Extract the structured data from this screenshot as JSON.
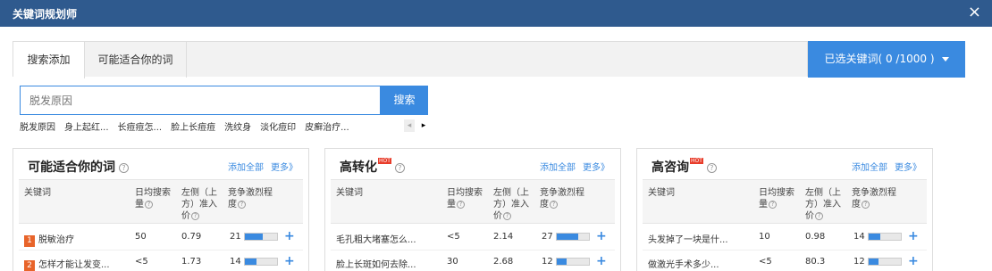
{
  "window": {
    "title": "关键词规划师",
    "close": "×"
  },
  "tabs": [
    {
      "label": "搜索添加"
    },
    {
      "label": "可能适合你的词"
    }
  ],
  "selected_button": {
    "label": "已选关键词( 0 /1000 )"
  },
  "search": {
    "placeholder": "脱发原因",
    "button": "搜索"
  },
  "suggestions": [
    "脱发原因",
    "身上起红...",
    "长痘痘怎...",
    "脸上长痘痘",
    "洗纹身",
    "淡化痘印",
    "皮癣治疗..."
  ],
  "suggest_nav": {
    "prev": "◂",
    "next": "▸"
  },
  "panels": [
    {
      "title": "可能适合你的词",
      "hot": "",
      "links": [
        "添加全部",
        "更多》"
      ],
      "headers": [
        "关键词",
        "日均搜索量",
        "左侧（上方）准入价",
        "竞争激烈程度"
      ],
      "rows": [
        {
          "rank": "1",
          "keyword": "脱敏治疗",
          "daily": "50",
          "price": "0.79",
          "competition": "21",
          "level": 0.55
        },
        {
          "rank": "2",
          "keyword": "怎样才能让发变...",
          "daily": "<5",
          "price": "1.73",
          "competition": "14",
          "level": 0.35
        }
      ]
    },
    {
      "title": "高转化",
      "hot": "HOT",
      "links": [
        "添加全部",
        "更多》"
      ],
      "headers": [
        "关键词",
        "日均搜索量",
        "左侧（上方）准入价",
        "竞争激烈程度"
      ],
      "rows": [
        {
          "rank": "",
          "keyword": "毛孔粗大堵塞怎么...",
          "daily": "<5",
          "price": "2.14",
          "competition": "27",
          "level": 0.68
        },
        {
          "rank": "",
          "keyword": "脸上长斑如何去除...",
          "daily": "30",
          "price": "2.68",
          "competition": "12",
          "level": 0.3
        }
      ]
    },
    {
      "title": "高咨询",
      "hot": "HOT",
      "links": [
        "添加全部",
        "更多》"
      ],
      "headers": [
        "关键词",
        "日均搜索量",
        "左侧（上方）准入价",
        "竞争激烈程度"
      ],
      "rows": [
        {
          "rank": "",
          "keyword": "头发掉了一块是什...",
          "daily": "10",
          "price": "0.98",
          "competition": "14",
          "level": 0.35
        },
        {
          "rank": "",
          "keyword": "做激光手术多少...",
          "daily": "<5",
          "price": "80.3",
          "competition": "12",
          "level": 0.3
        }
      ]
    }
  ],
  "colors": {
    "accent": "#3a8ae0",
    "titlebar": "#2f5a8e",
    "rank": "#e8642a",
    "hot": "#e83c2a"
  }
}
